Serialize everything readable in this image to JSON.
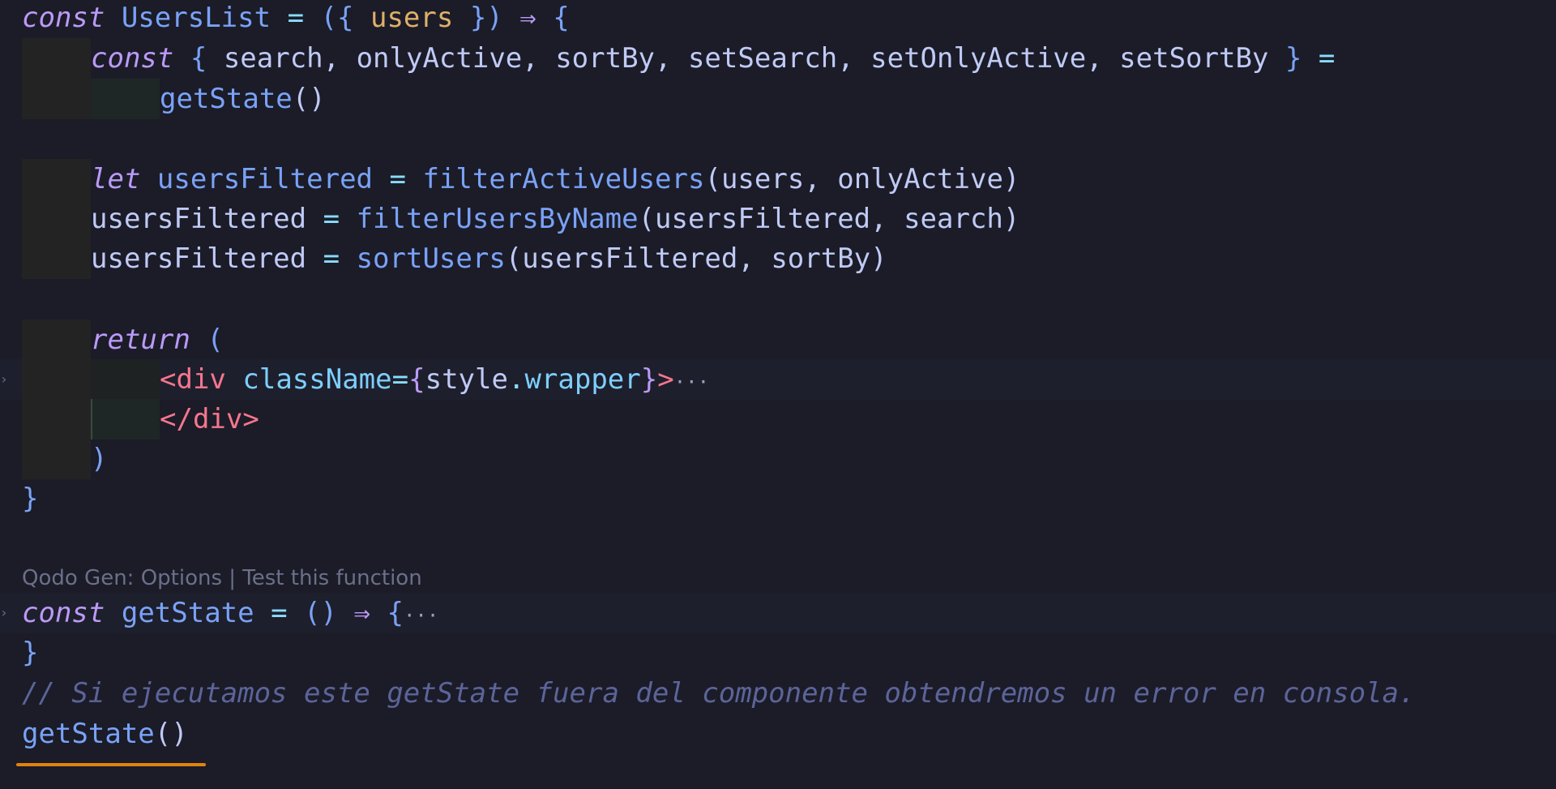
{
  "code": {
    "line1": {
      "kw": "const",
      "name": "UsersList",
      "eq": "=",
      "open": "({",
      "param": "users",
      "close": "})",
      "arrow": "⇒",
      "brace": "{"
    },
    "line2": {
      "kw": "const",
      "open": "{",
      "vars": "search, onlyActive, sortBy, setSearch, setOnlyActive, setSortBy",
      "close": "}",
      "eq": "="
    },
    "line3": {
      "call": "getState",
      "parens": "()"
    },
    "line5": {
      "kw": "let",
      "name": "usersFiltered",
      "eq": "=",
      "fn": "filterActiveUsers",
      "args": "(users, onlyActive)"
    },
    "line6": {
      "name": "usersFiltered",
      "eq": "=",
      "fn": "filterUsersByName",
      "args": "(usersFiltered, search)"
    },
    "line7": {
      "name": "usersFiltered",
      "eq": "=",
      "fn": "sortUsers",
      "args": "(usersFiltered, sortBy)"
    },
    "line9": {
      "kw": "return",
      "paren": "("
    },
    "line10": {
      "lt": "<",
      "tag": "div",
      "attr": "className",
      "eq": "=",
      "bo": "{",
      "obj": "style",
      "dot": ".",
      "prop": "wrapper",
      "bc": "}",
      "gt": ">",
      "folded": "···"
    },
    "line11": {
      "close": "</div>"
    },
    "line12": {
      "paren": ")"
    },
    "line13": {
      "brace": "}"
    },
    "codelens": "Qodo Gen: Options | Test this function",
    "line15": {
      "kw": "const",
      "name": "getState",
      "eq": "=",
      "parens": "()",
      "arrow": "⇒",
      "brace": "{",
      "folded": "···"
    },
    "line16": {
      "brace": "}"
    },
    "comment": "// Si ejecutamos este getState fuera del componente obtendremos un error en consola.",
    "line18": {
      "call": "getState",
      "parens": "()"
    }
  },
  "colors": {
    "background": "#1b1c28",
    "warning_squiggle": "#e2820e"
  }
}
